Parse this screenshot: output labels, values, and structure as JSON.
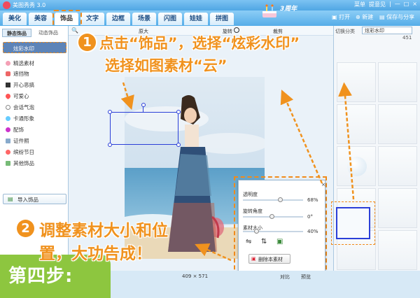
{
  "titlebar": {
    "title": "美图秀秀 3.0",
    "window_buttons": [
      "菜单",
      "提意见",
      "|",
      "—",
      "□",
      "×"
    ]
  },
  "tabs": [
    "美化",
    "美容",
    "饰品",
    "文字",
    "边框",
    "场景",
    "闪图",
    "娃娃",
    "拼图"
  ],
  "active_tab": "饰品",
  "anniversary": "3周年",
  "top_actions": {
    "open": "打开",
    "new": "新建",
    "save_share": "保存与分享"
  },
  "sidebar": {
    "tab_active": "静态饰品",
    "tab_other": "动态饰品",
    "selected": "炫彩水印",
    "items": [
      "精选素材",
      "遮挡物",
      "开心恶搞",
      "可爱心",
      "会话气泡",
      "卡通形象",
      "配饰",
      "证件照",
      "缤纷节日",
      "其他饰品"
    ],
    "import_button": "导入饰品"
  },
  "canvas_toolbar": {
    "original": "原大",
    "rotate": "旋转",
    "crop": "裁剪"
  },
  "canvas_status": {
    "size": "409 × 571",
    "compare": "对比",
    "preview": "预览"
  },
  "right_panel": {
    "label": "切换分类",
    "category": "炫彩水印",
    "page_num": "451"
  },
  "popup": {
    "opacity_label": "透明度",
    "opacity_value": "68%",
    "rotate_label": "旋转角度",
    "rotate_value": "0°",
    "size_label": "素材大小",
    "size_value": "40%",
    "delete_button": "删除本素材"
  },
  "annotations": {
    "step1_number": "1",
    "step1_line1": "点击“饰品”，选择“炫彩水印”",
    "step1_line2": "选择如图素材“云”",
    "step2_number": "2",
    "step2_line1": "调整素材大小和位",
    "step2_line2": "置，大功告成！"
  },
  "step_label": "第四步:",
  "colors": {
    "accent": "#f0921e",
    "step_green": "#8dc63f",
    "title_blue": "#4fa6e4",
    "selection_blue": "#2b3fd8"
  }
}
